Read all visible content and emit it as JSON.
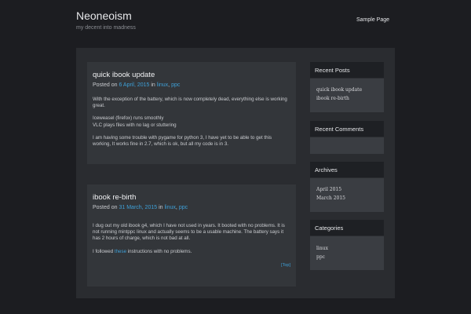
{
  "site": {
    "title": "Neoneoism",
    "description": "my decent into madness"
  },
  "nav": {
    "sample_page": "Sample Page"
  },
  "posts": [
    {
      "title": "quick ibook update",
      "posted_on": "Posted on",
      "date": "6 April, 2015",
      "in": "in",
      "category_1": "linux",
      "comma": ",",
      "category_2": "ppc",
      "paragraphs": [
        "With the exception of the battery, which is now completely dead, everything else is working great.",
        "Iceweasel (firefox) runs smoothly",
        "VLC plays files with no lag or stuttering",
        "I am having some trouble with pygame for python 3, I have yet to be able to get this working, It works fine in 2.7, which is ok, but all my code is in 3."
      ]
    },
    {
      "title": "ibook re-birth",
      "posted_on": "Posted on",
      "date": "31 March, 2015",
      "in": "in",
      "category_1": "linux",
      "comma": ",",
      "category_2": "ppc",
      "paragraphs": [
        "I dug out my old ibook g4, which I have not used in years. It booted with no problems. It is not running mintppc linux and actually seems to be a usable machine. The battery says it has 2 hours of charge, which is not bad at all."
      ],
      "followed_prefix": "I followed",
      "followed_link": "these",
      "followed_suffix": "instructions with no problems.",
      "top_link": "[Top]"
    }
  ],
  "widgets": {
    "recent_posts": {
      "title": "Recent Posts",
      "items": [
        "quick ibook update",
        "ibook re-birth"
      ]
    },
    "recent_comments": {
      "title": "Recent Comments"
    },
    "archives": {
      "title": "Archives",
      "items": [
        "April 2015",
        "March 2015"
      ]
    },
    "categories": {
      "title": "Categories",
      "items": [
        "linux",
        "ppc"
      ]
    }
  },
  "colors": {
    "background": "#1c1d21",
    "panel": "#2a2c30",
    "card": "#33363a",
    "link": "#3ea0d8"
  }
}
